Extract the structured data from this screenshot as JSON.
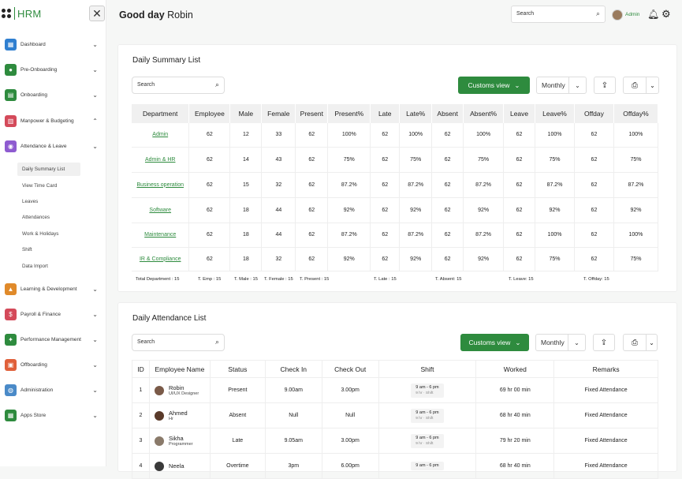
{
  "app": {
    "logo_text": "HRM"
  },
  "colors": {
    "accent": "#2e8b3e"
  },
  "sidebar": {
    "items": [
      {
        "label": "Dashboard",
        "icon": "dashboard-icon",
        "color": "#2f7fd0",
        "expanded": false
      },
      {
        "label": "Pre-Onboarding",
        "icon": "user-icon",
        "color": "#2e8b3e",
        "expanded": false
      },
      {
        "label": "Onboarding",
        "icon": "clipboard-icon",
        "color": "#2e8b3e",
        "expanded": false
      },
      {
        "label": "Manpower & Budgeting",
        "icon": "budget-icon",
        "color": "#d44a5a",
        "expanded": true
      },
      {
        "label": "Attendance & Leave",
        "icon": "attendance-icon",
        "color": "#8e5bd0",
        "expanded": true
      },
      {
        "label": "Learning & Development",
        "icon": "learning-icon",
        "color": "#e08a2a",
        "expanded": false
      },
      {
        "label": "Payroll & Finance",
        "icon": "payroll-icon",
        "color": "#d44a5a",
        "expanded": false
      },
      {
        "label": "Performance Management",
        "icon": "performance-icon",
        "color": "#2e8b3e",
        "expanded": false
      },
      {
        "label": "Offboarding",
        "icon": "offboarding-icon",
        "color": "#e0603a",
        "expanded": false
      },
      {
        "label": "Administration",
        "icon": "globe-icon",
        "color": "#4a8ac8",
        "expanded": false
      },
      {
        "label": "Apps Store",
        "icon": "apps-icon",
        "color": "#2e8b3e",
        "expanded": false
      }
    ],
    "subitems": [
      "Daily Summary List",
      "View Time Card",
      "Leaves",
      "Attendances",
      "Work & Holidays",
      "Shift",
      "Data Import"
    ]
  },
  "header": {
    "greeting": "Good day",
    "user": "Robin",
    "search_placeholder": "Search",
    "role": "Admin"
  },
  "summary": {
    "title": "Daily  Summary List",
    "search_placeholder": "Search",
    "customs_view": "Customs view",
    "period": "Monthly",
    "columns": [
      "Department",
      "Employee",
      "Male",
      "Female",
      "Present",
      "Present%",
      "Late",
      "Late%",
      "Absent",
      "Absent%",
      "Leave",
      "Leave%",
      "Offday",
      "Offday%"
    ],
    "rows": [
      [
        "Admin",
        "62",
        "12",
        "33",
        "62",
        "100%",
        "62",
        "100%",
        "62",
        "100%",
        "62",
        "100%",
        "62",
        "100%"
      ],
      [
        "Admin & HR",
        "62",
        "14",
        "43",
        "62",
        "75%",
        "62",
        "75%",
        "62",
        "75%",
        "62",
        "75%",
        "62",
        "75%"
      ],
      [
        "Business operation",
        "62",
        "15",
        "32",
        "62",
        "87.2%",
        "62",
        "87.2%",
        "62",
        "87.2%",
        "62",
        "87.2%",
        "62",
        "87.2%"
      ],
      [
        "Software",
        "62",
        "18",
        "44",
        "62",
        "92%",
        "62",
        "92%",
        "62",
        "92%",
        "62",
        "92%",
        "62",
        "92%"
      ],
      [
        "Maintenance",
        "62",
        "18",
        "44",
        "62",
        "87.2%",
        "62",
        "87.2%",
        "62",
        "87.2%",
        "62",
        "100%",
        "62",
        "100%"
      ],
      [
        "IR & Compliance",
        "62",
        "18",
        "32",
        "62",
        "92%",
        "62",
        "92%",
        "62",
        "92%",
        "62",
        "75%",
        "62",
        "75%"
      ]
    ],
    "totals": [
      "Total Department : 15",
      "T. Emp : 15",
      "T. Male : 15",
      "T. Female : 15",
      "T. Present : 15",
      "T. Late : 15",
      "T. Absent: 15",
      "T. Leave: 15",
      "T. Offday: 15"
    ]
  },
  "attendance": {
    "title": "Daily  Attendance List",
    "search_placeholder": "Search",
    "customs_view": "Customs view",
    "period": "Monthly",
    "columns": [
      "ID",
      "Employee Name",
      "Status",
      "Check In",
      "Check Out",
      "Shift",
      "Worked",
      "Remarks"
    ],
    "rows": [
      {
        "id": "1",
        "name": "Robin",
        "role": "UI/UX Designer",
        "status": "Present",
        "check_in": "9.00am",
        "check_out": "3.00pm",
        "shift_time": "9 am - 6 pm",
        "shift_meta": "9 hr · Shift",
        "worked": "69 hr 00 min",
        "remarks": "Fixed Attendance"
      },
      {
        "id": "2",
        "name": "Ahmed",
        "role": "Hr",
        "status": "Absent",
        "check_in": "Null",
        "check_out": "Null",
        "shift_time": "9 am - 6 pm",
        "shift_meta": "9 hr · Shift",
        "worked": "68 hr 40 min",
        "remarks": "Fixed Attendance"
      },
      {
        "id": "3",
        "name": "Sikha",
        "role": "Programmer",
        "status": "Late",
        "check_in": "9.05am",
        "check_out": "3.00pm",
        "shift_time": "9 am - 6 pm",
        "shift_meta": "9 hr · Shift",
        "worked": "79 hr 20 min",
        "remarks": "Fixed Attendance"
      },
      {
        "id": "4",
        "name": "Neela",
        "role": "",
        "status": "Overtime",
        "check_in": "3pm",
        "check_out": "6.00pm",
        "shift_time": "9 am - 6 pm",
        "shift_meta": "",
        "worked": "68 hr 40 min",
        "remarks": "Fixed Attendance"
      }
    ]
  }
}
